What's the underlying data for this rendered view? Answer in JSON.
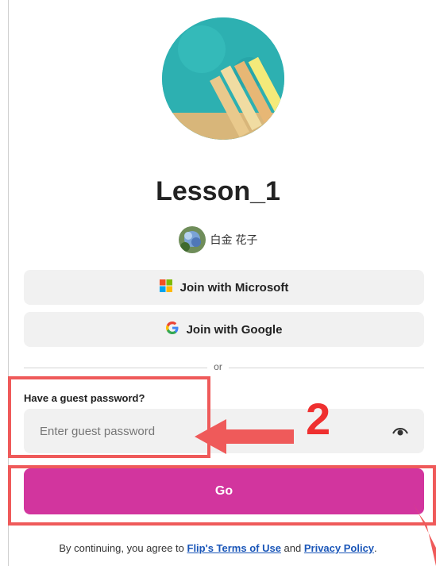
{
  "lesson": {
    "title": "Lesson_1"
  },
  "owner": {
    "name": "白金 花子"
  },
  "buttons": {
    "microsoft": "Join with Microsoft",
    "google": "Join with Google",
    "go": "Go"
  },
  "divider": {
    "text": "or"
  },
  "guest": {
    "label": "Have a guest password?",
    "placeholder": "Enter guest password",
    "value": ""
  },
  "legal": {
    "prefix": "By continuing, you agree to ",
    "terms": "Flip's Terms of Use",
    "and": " and ",
    "privacy": "Privacy Policy",
    "suffix": "."
  },
  "annotation": {
    "step": "2"
  },
  "colors": {
    "accent": "#d2359e",
    "annotation": "#ef5a5a",
    "link": "#1a56b8",
    "button_bg": "#f1f1f1"
  },
  "icons": [
    "microsoft-logo-icon",
    "google-logo-icon",
    "eye-icon"
  ]
}
